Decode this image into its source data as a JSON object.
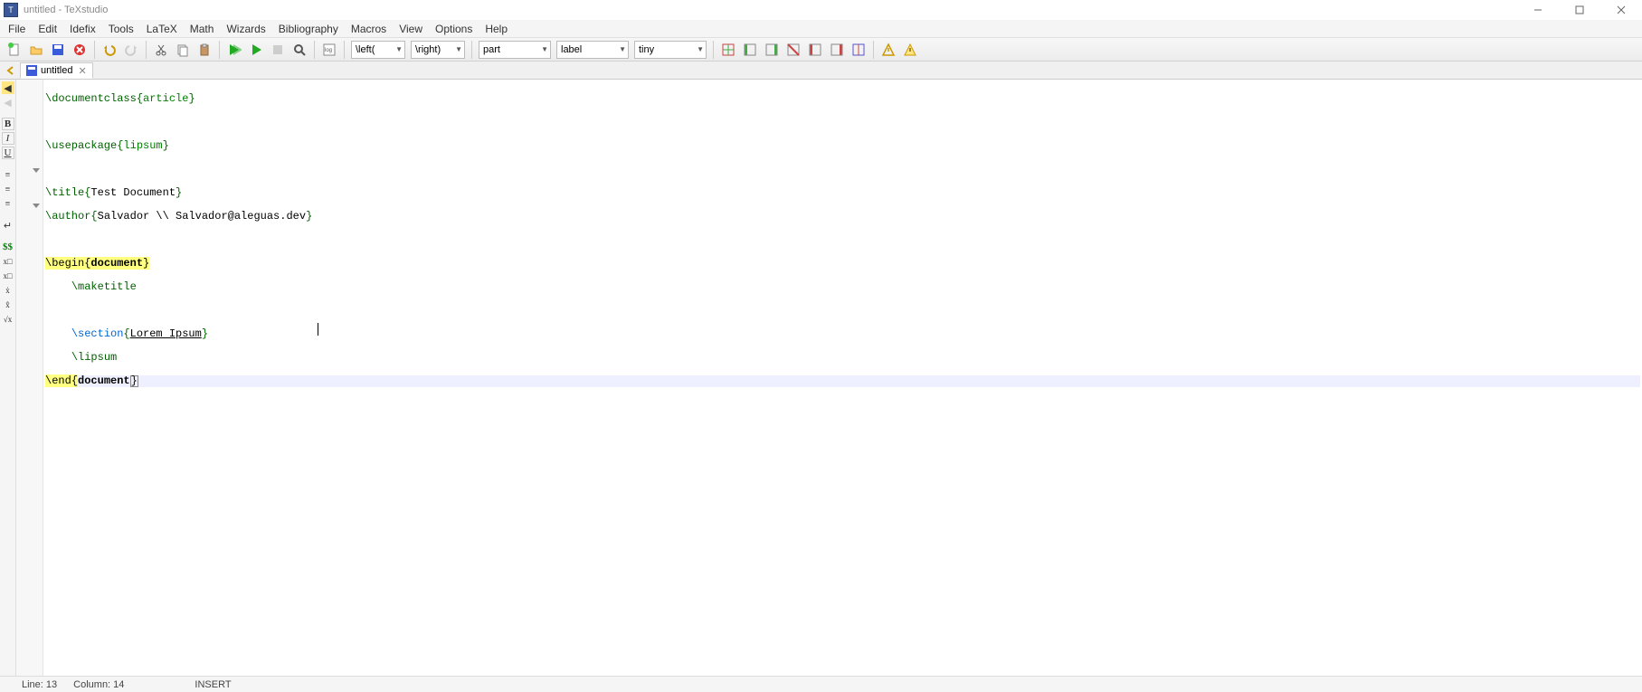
{
  "window": {
    "title": "untitled - TeXstudio",
    "controls": {
      "min": "—",
      "max": "☐",
      "close": "✕"
    }
  },
  "menu": [
    "File",
    "Edit",
    "Idefix",
    "Tools",
    "LaTeX",
    "Math",
    "Wizards",
    "Bibliography",
    "Macros",
    "View",
    "Options",
    "Help"
  ],
  "toolbar": {
    "combos": {
      "left_delim": "\\left(",
      "right_delim": "\\right)",
      "section": "part",
      "refstyle": "label",
      "size": "tiny"
    }
  },
  "tab": {
    "name": "untitled"
  },
  "sidebar_buttons": [
    "B",
    "I",
    "U",
    "≡",
    "≡",
    "≡",
    "↵",
    "$$",
    "x□",
    "x□",
    "ẋ",
    "x̂",
    "√x"
  ],
  "code": {
    "l1_cmd": "\\documentclass",
    "l1_brace_o": "{",
    "l1_arg": "article",
    "l1_brace_c": "}",
    "l3_cmd": "\\usepackage",
    "l3_brace_o": "{",
    "l3_arg": "lipsum",
    "l3_brace_c": "}",
    "l5_cmd": "\\title",
    "l5_brace_o": "{",
    "l5_arg": "Test Document",
    "l5_brace_c": "}",
    "l6_cmd": "\\author",
    "l6_brace_o": "{",
    "l6_arg": "Salvador \\\\ Salvador@aleguas.dev",
    "l6_brace_c": "}",
    "l8_cmd": "\\begin",
    "l8_brace_o": "{",
    "l8_arg": "document",
    "l8_brace_c": "}",
    "l9_indent": "    ",
    "l9_cmd": "\\maketitle",
    "l11_indent": "    ",
    "l11_cmd": "\\section",
    "l11_brace_o": "{",
    "l11_arg": "Lorem Ipsum",
    "l11_brace_c": "}",
    "l12_indent": "    ",
    "l12_cmd": "\\lipsum",
    "l13_cmd": "\\end",
    "l13_brace_o": "{",
    "l13_arg": "document",
    "l13_brace_c": "}"
  },
  "status": {
    "line": "Line: 13",
    "column": "Column: 14",
    "mode": "INSERT"
  }
}
